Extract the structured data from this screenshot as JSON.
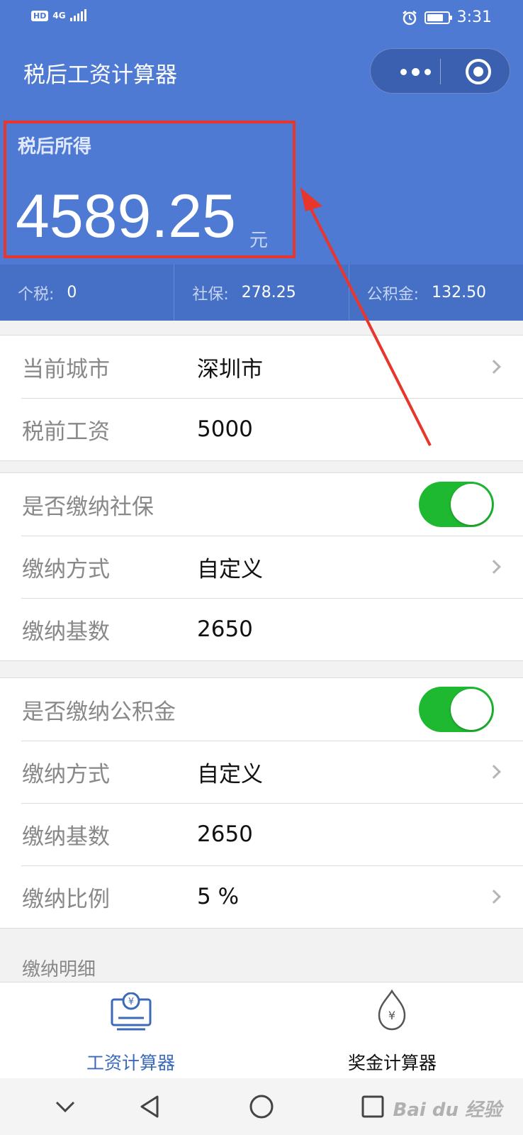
{
  "status_bar": {
    "hd": "HD",
    "network": "4G",
    "time": "3:31"
  },
  "header": {
    "title": "税后工资计算器"
  },
  "result": {
    "label": "税后所得",
    "value": "4589.25",
    "unit": "元"
  },
  "summary": [
    {
      "key": "个税:",
      "value": "0"
    },
    {
      "key": "社保:",
      "value": "278.25"
    },
    {
      "key": "公积金:",
      "value": "132.50"
    }
  ],
  "basic": {
    "city_label": "当前城市",
    "city_value": "深圳市",
    "salary_label": "税前工资",
    "salary_value": "5000"
  },
  "social": {
    "toggle_label": "是否缴纳社保",
    "toggle_on": true,
    "mode_label": "缴纳方式",
    "mode_value": "自定义",
    "base_label": "缴纳基数",
    "base_value": "2650"
  },
  "fund": {
    "toggle_label": "是否缴纳公积金",
    "toggle_on": true,
    "mode_label": "缴纳方式",
    "mode_value": "自定义",
    "base_label": "缴纳基数",
    "base_value": "2650",
    "ratio_label": "缴纳比例",
    "ratio_value": "5 %"
  },
  "detail": {
    "label": "缴纳明细"
  },
  "tabs": {
    "salary": "工资计算器",
    "bonus": "奖金计算器",
    "active": "salary"
  },
  "colors": {
    "header_bg": "#4e7ad4",
    "summary_bg": "#4670c6",
    "toggle_on": "#1eb931",
    "active_tab": "#3b6ab8",
    "annotation": "#e8362c"
  },
  "icons": {
    "menu": "more-dots-icon",
    "close": "target-circle-icon",
    "nav": [
      "chevron-down-icon",
      "back-triangle-icon",
      "home-circle-icon",
      "recents-square-icon"
    ]
  },
  "watermark": "Bai du 经验"
}
